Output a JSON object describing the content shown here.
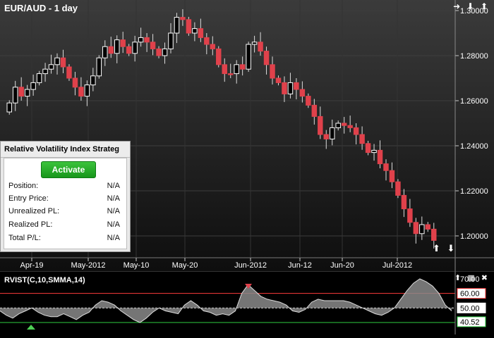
{
  "chart": {
    "title": "EUR/AUD - 1 day",
    "y_ticks": [
      "1.30000",
      "1.28000",
      "1.26000",
      "1.24000",
      "1.22000",
      "1.20000"
    ],
    "x_ticks": [
      "Apr-19",
      "May-2012",
      "May-10",
      "May-20",
      "Jun-2012",
      "Jun-12",
      "Jun-20",
      "Jul-2012"
    ]
  },
  "indicator": {
    "title": "RVIST(C,10,SMMA,14)",
    "levels": [
      "70.00",
      "60.00",
      "50.00",
      "40.52"
    ],
    "colors": {
      "upper": "#ff3b3b",
      "lower": "#2ecc40",
      "fill": "#8a8a8a",
      "negfill": "#7a5555"
    }
  },
  "icons": {
    "main": [
      "arrow-right-icon",
      "arrow-down-icon",
      "arrow-up-icon"
    ],
    "indicator": [
      "arrow-up-icon",
      "grid-icon",
      "close-icon"
    ],
    "bottom": [
      "arrow-up-icon",
      "arrow-down-icon"
    ]
  },
  "panel": {
    "title": "Relative Volatility Index Strateg",
    "activate": "Activate",
    "rows": [
      {
        "label": "Position:",
        "value": "N/A"
      },
      {
        "label": "Entry Price:",
        "value": "N/A"
      },
      {
        "label": "Unrealized PL:",
        "value": "N/A"
      },
      {
        "label": "Realized PL:",
        "value": "N/A"
      },
      {
        "label": "Total P/L:",
        "value": "N/A"
      }
    ]
  }
}
